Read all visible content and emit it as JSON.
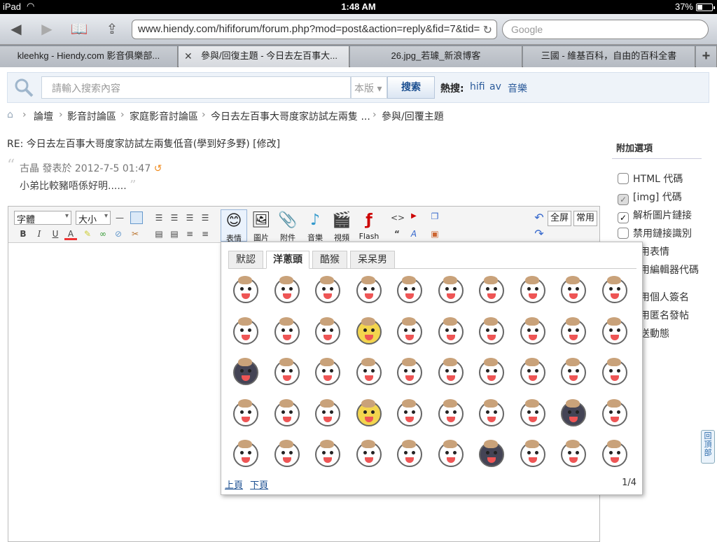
{
  "status": {
    "device": "iPad",
    "time": "1:48 AM",
    "battery": "37%",
    "battery_level": 0.37
  },
  "browser": {
    "url": "www.hiendy.com/hififorum/forum.php?mod=post&action=reply&fid=7&tid=",
    "search_placeholder": "Google",
    "tabs": [
      {
        "label": "kleehkg - Hiendy.com 影音俱樂部..."
      },
      {
        "label": "參與/回復主題 - 今日去左百事大..."
      },
      {
        "label": "26.jpg_若璩_新浪博客"
      },
      {
        "label": "三國 - 維基百科，自由的百科全書"
      }
    ],
    "add_tab": "+"
  },
  "search": {
    "placeholder": "請輸入搜索內容",
    "scope": "本版",
    "button": "搜索",
    "hot_label": "熱搜:",
    "hot": [
      "hifi",
      "av",
      "音樂"
    ]
  },
  "breadcrumbs": [
    "論壇",
    "影音討論區",
    "家庭影音討論區",
    "今日去左百事大哥度家訪試左兩隻 ...",
    "參與/回覆主題"
  ],
  "post": {
    "title": "RE: 今日去左百事大哥度家訪試左兩隻低音(學到好多野) [修改]",
    "quote_meta": "古晶 發表於 2012-7-5 01:47",
    "quote_text": "小弟比較豬唔係好明......"
  },
  "options": {
    "heading": "附加選項",
    "items": [
      {
        "label": "HTML 代碼",
        "state": "unchecked"
      },
      {
        "label": "[img] 代碼",
        "state": "disabled"
      },
      {
        "label": "解析圖片鏈接",
        "state": "checked"
      },
      {
        "label": "禁用鏈接識別",
        "state": "unchecked"
      },
      {
        "label": "用表情",
        "state": "hidden"
      },
      {
        "label": "用編輯器代碼",
        "state": "hidden"
      },
      {
        "label": "用個人簽名",
        "state": "hidden"
      },
      {
        "label": "用匿名發帖",
        "state": "hidden"
      },
      {
        "label": "送動態",
        "state": "hidden"
      }
    ]
  },
  "editor": {
    "font": "字體",
    "size": "大小",
    "tools": {
      "emoticon": "表情",
      "image": "圖片",
      "attachment": "附件",
      "music": "音樂",
      "video": "視頻",
      "flash": "Flash"
    },
    "fullscreen": "全屏",
    "common": "常用"
  },
  "smiley": {
    "tabs": [
      "默認",
      "洋蔥頭",
      "酷猴",
      "呆呆男"
    ],
    "active_tab": "洋蔥頭",
    "prev": "上頁",
    "next": "下頁",
    "page": "1/4"
  },
  "totop": "回頂部"
}
